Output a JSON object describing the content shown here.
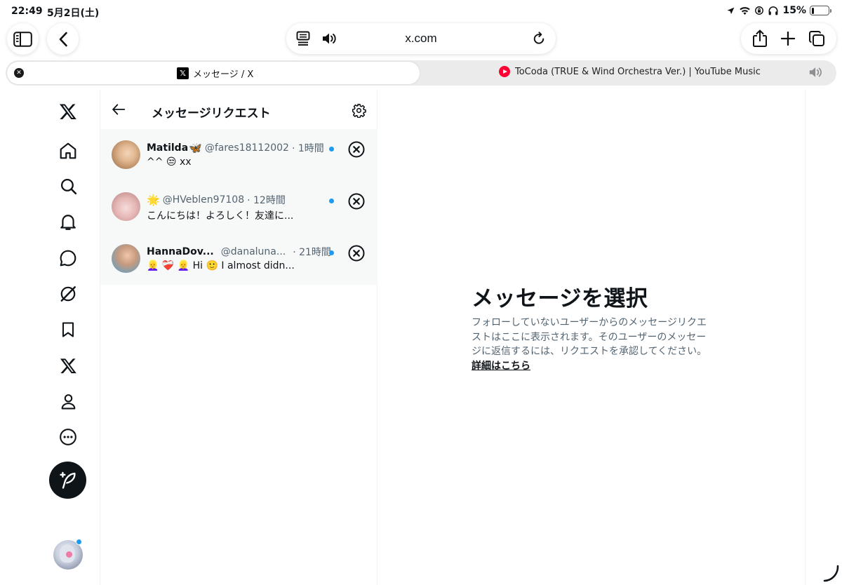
{
  "status_bar": {
    "time": "22:49",
    "date": "5月2日(土)",
    "battery": "15%",
    "battery_level": 0.15
  },
  "browser": {
    "url": "x.com",
    "tabs": [
      {
        "title": "メッセージ / X",
        "active": true
      },
      {
        "title": "ToCoda (TRUE & Wind Orchestra Ver.) | YouTube Music",
        "active": false
      }
    ]
  },
  "nav": {
    "items": [
      "x-logo-icon",
      "home-icon",
      "search-icon",
      "notifications-icon",
      "messages-icon",
      "grok-icon",
      "bookmarks-icon",
      "premium-icon",
      "profile-icon",
      "more-icon"
    ]
  },
  "requests_panel": {
    "title": "メッセージリクエスト",
    "items": [
      {
        "name": "Matilda",
        "handle": "@fares18112002",
        "time": "· 1時間",
        "preview": "^^ 😒 xx"
      },
      {
        "name": "",
        "handle": "@HVeblen97108",
        "time": "· 12時間",
        "preview": "こんにちは！よろしく！友達に..."
      },
      {
        "name": "HannaDov...",
        "handle": "@danaluna...",
        "time": "· 21時間",
        "preview": "👱‍♀️ ❤️‍🩹 👱‍♀️ Hi 🙂 I almost didn..."
      }
    ]
  },
  "detail": {
    "title": "メッセージを選択",
    "description": "フォローしていないユーザーからのメッセージリクエストはここに表示されます。そのユーザーのメッセージに返信するには、リクエストを承認してください。",
    "link": "詳細はこちら"
  },
  "colors": {
    "accent": "#1d9bf0",
    "text_primary": "#0f1419",
    "text_secondary": "#536471",
    "list_bg": "#f7f9f9"
  }
}
